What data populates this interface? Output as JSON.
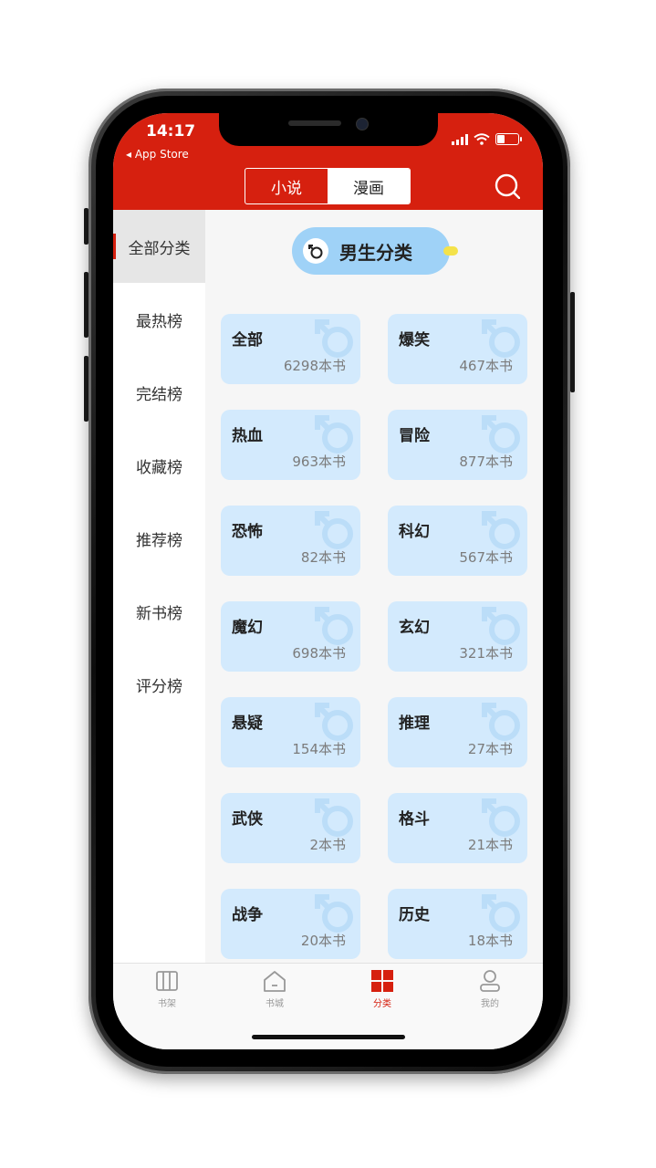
{
  "status_bar": {
    "time": "14:17",
    "back_label": "◂ App Store"
  },
  "header": {
    "segments": [
      {
        "label": "小说",
        "active": false
      },
      {
        "label": "漫画",
        "active": true
      }
    ]
  },
  "sidebar": {
    "items": [
      {
        "label": "全部分类",
        "active": true
      },
      {
        "label": "最热榜",
        "active": false
      },
      {
        "label": "完结榜",
        "active": false
      },
      {
        "label": "收藏榜",
        "active": false
      },
      {
        "label": "推荐榜",
        "active": false
      },
      {
        "label": "新书榜",
        "active": false
      },
      {
        "label": "评分榜",
        "active": false
      }
    ]
  },
  "category_header": {
    "label": "男生分类",
    "icon": "male-symbol-icon"
  },
  "categories": [
    {
      "name": "全部",
      "count": "6298本书"
    },
    {
      "name": "爆笑",
      "count": "467本书"
    },
    {
      "name": "热血",
      "count": "963本书"
    },
    {
      "name": "冒险",
      "count": "877本书"
    },
    {
      "name": "恐怖",
      "count": "82本书"
    },
    {
      "name": "科幻",
      "count": "567本书"
    },
    {
      "name": "魔幻",
      "count": "698本书"
    },
    {
      "name": "玄幻",
      "count": "321本书"
    },
    {
      "name": "悬疑",
      "count": "154本书"
    },
    {
      "name": "推理",
      "count": "27本书"
    },
    {
      "name": "武侠",
      "count": "2本书"
    },
    {
      "name": "格斗",
      "count": "21本书"
    },
    {
      "name": "战争",
      "count": "20本书"
    },
    {
      "name": "历史",
      "count": "18本书"
    }
  ],
  "tabbar": {
    "items": [
      {
        "label": "书架",
        "icon": "bookshelf-icon",
        "active": false
      },
      {
        "label": "书城",
        "icon": "home-icon",
        "active": false
      },
      {
        "label": "分类",
        "icon": "category-grid-icon",
        "active": true
      },
      {
        "label": "我的",
        "icon": "user-icon",
        "active": false
      }
    ]
  },
  "colors": {
    "accent": "#d6200f",
    "card_bg": "#d3eafd",
    "pill_bg": "#9fd2f7"
  }
}
